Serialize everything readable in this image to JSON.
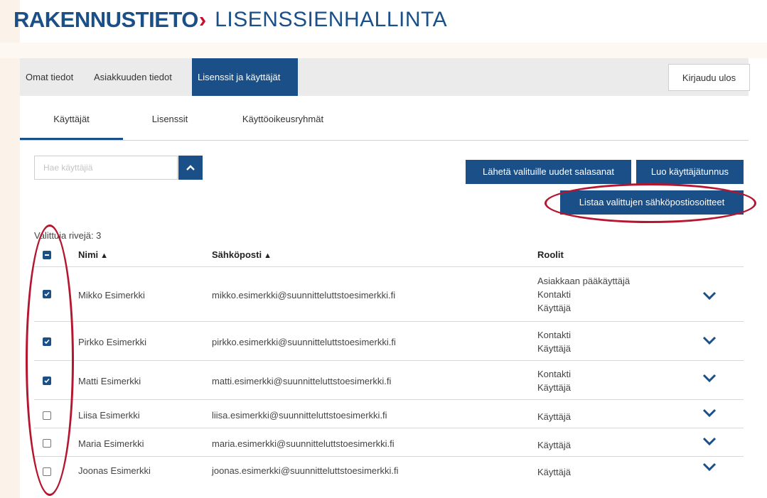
{
  "header": {
    "brand": "RAKENNUSTIETO",
    "brand_mark": "›",
    "app_title": "LISENSSIENHALLINTA"
  },
  "top_nav": {
    "tabs": [
      {
        "label": "Omat tiedot",
        "active": false
      },
      {
        "label": "Asiakkuuden tiedot",
        "active": false
      },
      {
        "label": "Lisenssit ja käyttäjät",
        "active": true
      }
    ],
    "logout_label": "Kirjaudu ulos"
  },
  "sub_tabs": [
    {
      "label": "Käyttäjät",
      "active": true
    },
    {
      "label": "Lisenssit",
      "active": false
    },
    {
      "label": "Käyttöoikeusryhmät",
      "active": false
    }
  ],
  "search": {
    "placeholder": "Hae käyttäjiä",
    "toggle_icon": "chevron-up-icon"
  },
  "actions": {
    "send_passwords": "Lähetä valituille uudet salasanat",
    "create_user": "Luo käyttäjätunnus",
    "list_emails": "Listaa valittujen sähköpostiosoitteet"
  },
  "table": {
    "selected_count_text": "Valittuja rivejä: 3",
    "headers": {
      "name": "Nimi",
      "email": "Sähköposti",
      "roles": "Roolit"
    },
    "rows": [
      {
        "checked": true,
        "name": "Mikko Esimerkki",
        "email": "mikko.esimerkki@suunnitteluttstoesimerkki.fi",
        "roles": [
          "Asiakkaan pääkäyttäjä",
          "Kontakti",
          "Käyttäjä"
        ]
      },
      {
        "checked": true,
        "name": "Pirkko Esimerkki",
        "email": "pirkko.esimerkki@suunnitteluttstoesimerkki.fi",
        "roles": [
          "Kontakti",
          "Käyttäjä"
        ]
      },
      {
        "checked": true,
        "name": "Matti Esimerkki",
        "email": "matti.esimerkki@suunnitteluttstoesimerkki.fi",
        "roles": [
          "Kontakti",
          "Käyttäjä"
        ]
      },
      {
        "checked": false,
        "name": "Liisa Esimerkki",
        "email": "liisa.esimerkki@suunnitteluttstoesimerkki.fi",
        "roles": [
          "Käyttäjä"
        ]
      },
      {
        "checked": false,
        "name": "Maria Esimerkki",
        "email": "maria.esimerkki@suunnitteluttstoesimerkki.fi",
        "roles": [
          "Käyttäjä"
        ]
      },
      {
        "checked": false,
        "name": "Joonas Esimerkki",
        "email": "joonas.esimerkki@suunnitteluttstoesimerkki.fi",
        "roles": [
          "Käyttäjä"
        ]
      }
    ]
  },
  "colors": {
    "primary": "#1a4f87",
    "accent_red": "#c8102e",
    "annotation_red": "#b5152e"
  }
}
